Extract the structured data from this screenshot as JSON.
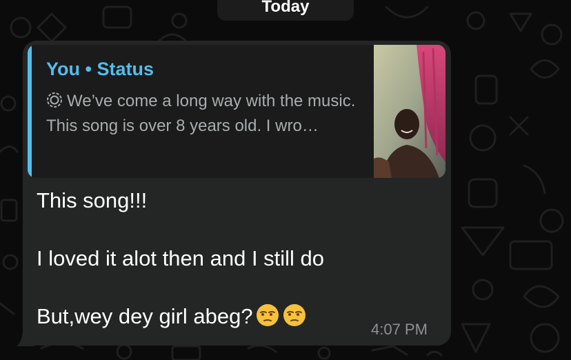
{
  "chat": {
    "date_separator": "Today"
  },
  "reply_quote": {
    "title": "You • Status",
    "status_icon": "status-ring-icon",
    "line1": "We’ve come a long way with the music.",
    "line2": "This song is over 8 years old. I wro…",
    "accent_color": "#53bdeb",
    "thumbnail": "status-photo-thumbnail"
  },
  "message": {
    "line1": "This song!!!",
    "line2": "I loved it alot then and I still do",
    "line3": "But,wey dey girl abeg?",
    "emojis": [
      "unamused-face-emoji",
      "unamused-face-emoji"
    ],
    "time": "4:07 PM"
  },
  "colors": {
    "bubble": "#242626",
    "quote_background": "#1b1b1b",
    "wallpaper": "#0b0b0b",
    "timestamp": "#8d9194"
  }
}
